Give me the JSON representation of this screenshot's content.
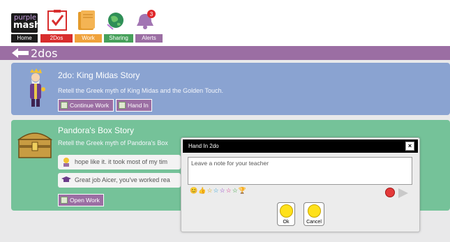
{
  "brand": {
    "line1": "purple",
    "line2": "mash"
  },
  "nav": [
    {
      "label": "Home",
      "color": "#1b1b1b",
      "icon": "purple-mash-logo"
    },
    {
      "label": "2Dos",
      "color": "#d82d2d",
      "icon": "checklist-icon"
    },
    {
      "label": "Work",
      "color": "#f0a23b",
      "icon": "folders-icon"
    },
    {
      "label": "Sharing",
      "color": "#46a05a",
      "icon": "globe-icon"
    },
    {
      "label": "Alerts",
      "color": "#9b6ea3",
      "icon": "bell-icon",
      "badge": "3"
    }
  ],
  "page_title": "2dos",
  "cards": [
    {
      "title": "2do: King Midas Story",
      "description": "Retell the Greek myth of King Midas and the Golden Touch.",
      "buttons": [
        "Continue Work",
        "Hand In"
      ]
    },
    {
      "title": "Pandora's Box Story",
      "description": "Retell the Greek myth of Pandora's Box",
      "comments": [
        "hope like it. it took most of my tim",
        "Great job Aicer, you've worked rea"
      ],
      "buttons": [
        "Open Work"
      ]
    }
  ],
  "dialog": {
    "title": "Hand In 2do",
    "close_label": "×",
    "note_placeholder": "Leave a note for your teacher",
    "emojis": [
      "😊",
      "👍",
      "☆",
      "☆",
      "☆",
      "☆",
      "☆",
      "🏆"
    ],
    "ok_label": "Ok",
    "cancel_label": "Cancel"
  },
  "colors": {
    "accent_purple": "#9b6ea3",
    "card_blue": "#8aa3d1",
    "card_green": "#75c299"
  }
}
